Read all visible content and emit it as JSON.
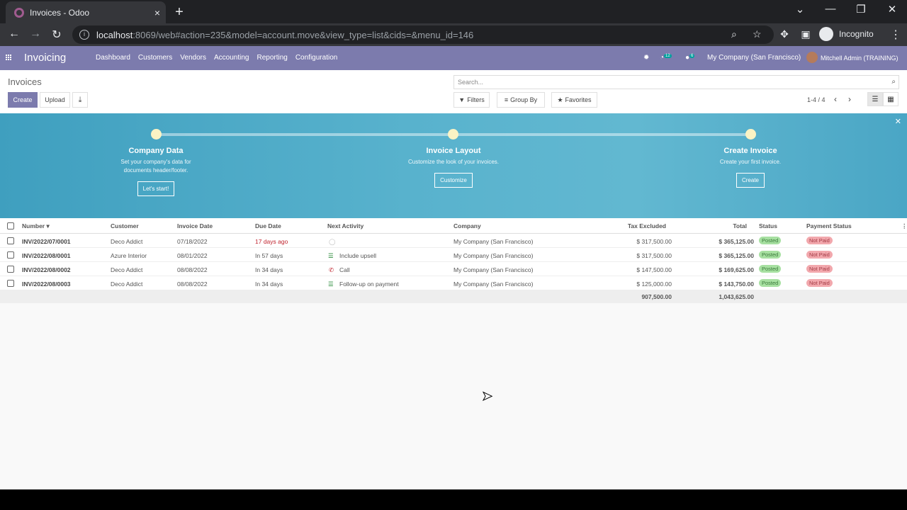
{
  "browser": {
    "tab_title": "Invoices - Odoo",
    "tab_close": "×",
    "new_tab": "+",
    "url_host": "localhost",
    "url_path": ":8069/web#action=235&model=account.move&view_type=list&cids=&menu_id=146",
    "profile_label": "Incognito"
  },
  "topbar": {
    "app_name": "Invoicing",
    "menu": [
      "Dashboard",
      "Customers",
      "Vendors",
      "Accounting",
      "Reporting",
      "Configuration"
    ],
    "activity_count": "12",
    "message_count": "6",
    "company": "My Company (San Francisco)",
    "user": "Mitchell Admin (TRAINING)"
  },
  "control_panel": {
    "title": "Invoices",
    "create_label": "Create",
    "upload_label": "Upload",
    "search_placeholder": "Search...",
    "filters_label": "Filters",
    "groupby_label": "Group By",
    "favorites_label": "Favorites",
    "pager": "1-4 / 4"
  },
  "onboarding": {
    "steps": [
      {
        "title": "Company Data",
        "desc1": "Set your company's data for",
        "desc2": "documents header/footer.",
        "button": "Let's start!"
      },
      {
        "title": "Invoice Layout",
        "desc1": "Customize the look of your invoices.",
        "desc2": "",
        "button": "Customize"
      },
      {
        "title": "Create Invoice",
        "desc1": "Create your first invoice.",
        "desc2": "",
        "button": "Create"
      }
    ]
  },
  "table": {
    "columns": [
      "Number",
      "Customer",
      "Invoice Date",
      "Due Date",
      "Next Activity",
      "Company",
      "Tax Excluded",
      "Total",
      "Status",
      "Payment Status"
    ],
    "rows": [
      {
        "number": "INV/2022/07/0001",
        "customer": "Deco Addict",
        "invoice_date": "07/18/2022",
        "due_date": "17 days ago",
        "activity": "",
        "company": "My Company (San Francisco)",
        "tax_excluded": "$ 317,500.00",
        "total": "$ 365,125.00",
        "status": "Posted",
        "payment": "Not Paid"
      },
      {
        "number": "INV/2022/08/0001",
        "customer": "Azure Interior",
        "invoice_date": "08/01/2022",
        "due_date": "In 57 days",
        "activity": "Include upsell",
        "company": "My Company (San Francisco)",
        "tax_excluded": "$ 317,500.00",
        "total": "$ 365,125.00",
        "status": "Posted",
        "payment": "Not Paid"
      },
      {
        "number": "INV/2022/08/0002",
        "customer": "Deco Addict",
        "invoice_date": "08/08/2022",
        "due_date": "In 34 days",
        "activity": "Call",
        "company": "My Company (San Francisco)",
        "tax_excluded": "$ 147,500.00",
        "total": "$ 169,625.00",
        "status": "Posted",
        "payment": "Not Paid"
      },
      {
        "number": "INV/2022/08/0003",
        "customer": "Deco Addict",
        "invoice_date": "08/08/2022",
        "due_date": "In 34 days",
        "activity": "Follow-up on payment",
        "company": "My Company (San Francisco)",
        "tax_excluded": "$ 125,000.00",
        "total": "$ 143,750.00",
        "status": "Posted",
        "payment": "Not Paid"
      }
    ],
    "totals": {
      "tax_excluded": "907,500.00",
      "total": "1,043,625.00"
    }
  }
}
